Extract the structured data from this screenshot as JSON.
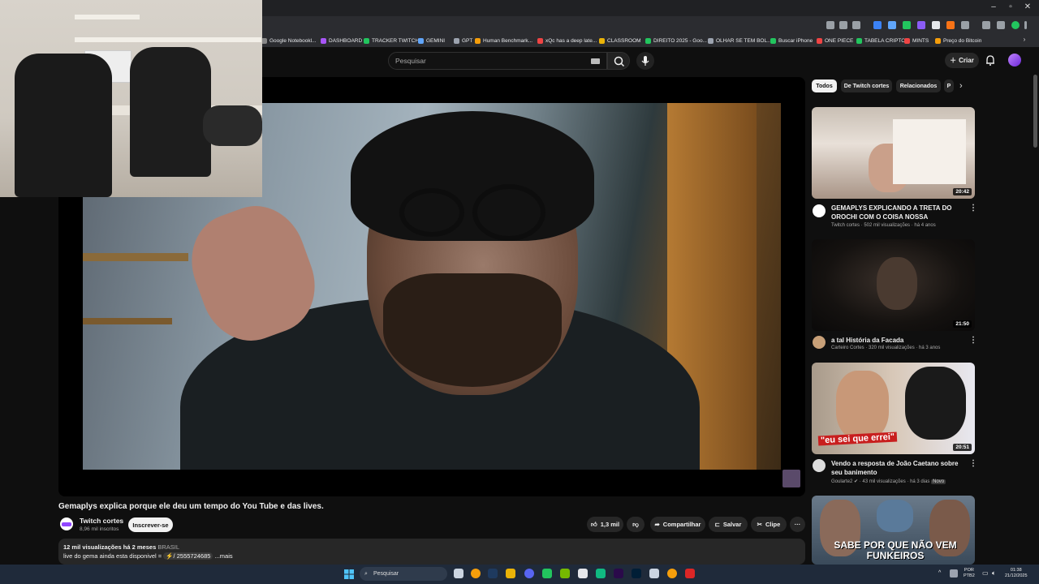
{
  "bookmarks": [
    {
      "label": "Google Notebookl...",
      "color": "#888888"
    },
    {
      "label": "DASHBOARD",
      "color": "#a855f7"
    },
    {
      "label": "TRACKER TWITCH",
      "color": "#22c55e"
    },
    {
      "label": "GEMINI",
      "color": "#60a5fa"
    },
    {
      "label": "GPT",
      "color": "#9ca3af"
    },
    {
      "label": "Human Benchmark...",
      "color": "#f59e0b"
    },
    {
      "label": "xQc has a deep late...",
      "color": "#ef4444"
    },
    {
      "label": "CLASSROOM",
      "color": "#eab308"
    },
    {
      "label": "DIREITO 2025 - Goo...",
      "color": "#22c55e"
    },
    {
      "label": "OLHAR SE TEM BOL...",
      "color": "#9ca3af"
    },
    {
      "label": "Buscar iPhone",
      "color": "#22c55e"
    },
    {
      "label": "ONE PIECE",
      "color": "#ef4444"
    },
    {
      "label": "TABELA CRIPTO",
      "color": "#22c55e"
    },
    {
      "label": "MINTS",
      "color": "#ef4444"
    },
    {
      "label": "Preço do Bitcoin",
      "color": "#f59e0b"
    }
  ],
  "header": {
    "search_placeholder": "Pesquisar",
    "create_label": "Criar"
  },
  "video": {
    "title": "Gemaplys explica porque ele deu um tempo do You Tube e das lives.",
    "channel": "Twitch cortes",
    "subscribers": "8,96 mil inscritos",
    "subscribe_label": "Inscrever-se",
    "likes": "1,3 mil",
    "share_label": "Compartilhar",
    "save_label": "Salvar",
    "clip_label": "Clipe",
    "views_date": "12 mil visualizações  há 2 meses",
    "country": "BRASIL",
    "desc_prefix": "live do gema ainda esta disponivel = ",
    "desc_tag": "⚡/ 2555724685",
    "more_label": "...mais"
  },
  "chips": [
    "Todos",
    "De Twitch cortes",
    "Relacionados",
    "P"
  ],
  "related": [
    {
      "title": "GEMAPLYS EXPLICANDO A TRETA DO OROCHI COM O COISA NOSSA",
      "meta": "Twitch cortes · 502 mil visualizações · há 4 anos",
      "duration": "20:42",
      "new": ""
    },
    {
      "title": "a tal História da Facada",
      "meta": "Carteiro Cortes · 320 mil visualizações · há 3 anos",
      "duration": "21:50",
      "new": ""
    },
    {
      "title": "Vendo a resposta de João Caetano sobre seu banimento",
      "meta": "Goularte2 ✔ · 43 mil visualizações · há 3 dias",
      "duration": "20:51",
      "new": "Novo",
      "thumb_text": "\"eu sei que errei\""
    },
    {
      "title": "",
      "meta": "",
      "duration": "",
      "new": "",
      "thumb_text": "SABE POR QUE NÃO VEM FUNKEIROS"
    }
  ],
  "taskbar": {
    "search_label": "Pesquisar",
    "lang_top": "POR",
    "lang_bottom": "PTB2",
    "time": "01:38",
    "date": "21/12/2025"
  },
  "colors": {
    "background": "#0f0f0f",
    "accent_twitch": "#9146ff",
    "taskbar": "#1f2a3a"
  }
}
